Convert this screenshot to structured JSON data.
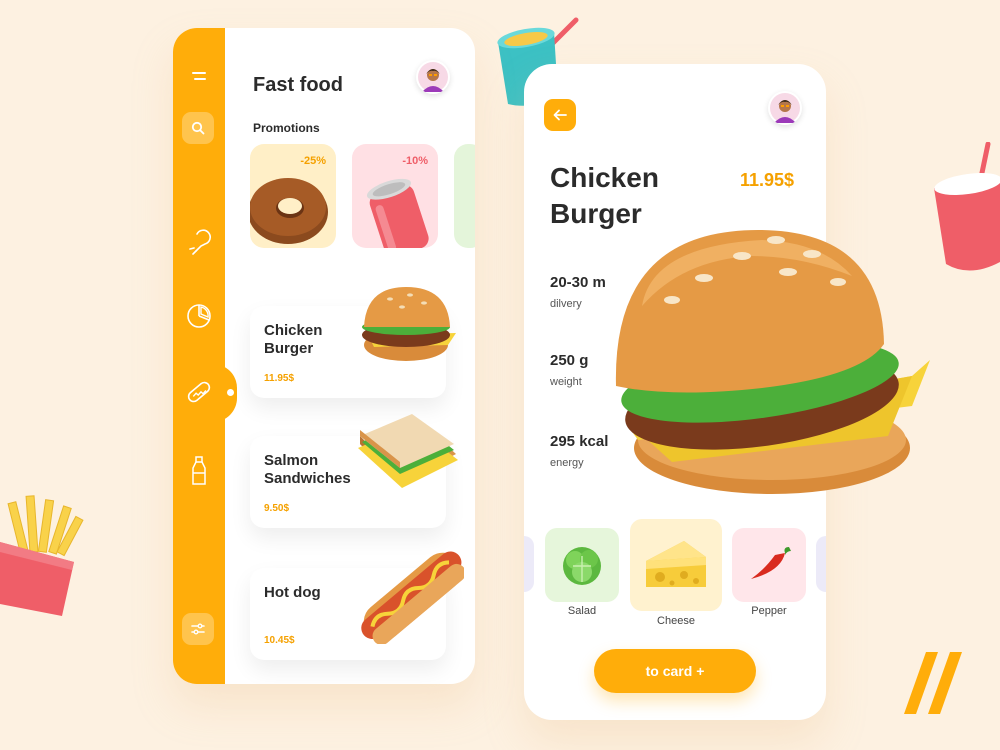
{
  "colors": {
    "accent": "#ffad0a",
    "price": "#f5a100",
    "background": "#fdf1e1"
  },
  "sidebar": {
    "items": [
      {
        "icon": "menu-icon"
      },
      {
        "icon": "search-icon"
      },
      {
        "icon": "chicken-leg-icon"
      },
      {
        "icon": "pie-chart-icon"
      },
      {
        "icon": "hotdog-icon"
      },
      {
        "icon": "bottle-icon"
      },
      {
        "icon": "settings-icon"
      }
    ]
  },
  "list_screen": {
    "title": "Fast food",
    "promotions_label": "Promotions",
    "promotions": [
      {
        "discount": "-25%",
        "item_icon": "donut-icon"
      },
      {
        "discount": "-10%",
        "item_icon": "soda-can-icon"
      }
    ],
    "items": [
      {
        "name": "Chicken Burger",
        "price": "11.95$",
        "icon": "burger-icon"
      },
      {
        "name": "Salmon Sandwiches",
        "price": "9.50$",
        "icon": "sandwich-icon"
      },
      {
        "name": "Hot dog",
        "price": "10.45$",
        "icon": "hotdog-food-icon"
      }
    ]
  },
  "detail_screen": {
    "title": "Chicken Burger",
    "price": "11.95$",
    "stats": [
      {
        "value": "20-30 m",
        "label": "dilvery"
      },
      {
        "value": "250 g",
        "label": "weight"
      },
      {
        "value": "295 kcal",
        "label": "energy"
      }
    ],
    "ingredients": [
      {
        "name": "Salad",
        "icon": "salad-icon"
      },
      {
        "name": "Cheese",
        "icon": "cheese-icon"
      },
      {
        "name": "Pepper",
        "icon": "pepper-icon"
      }
    ],
    "button_label": "to card +"
  }
}
